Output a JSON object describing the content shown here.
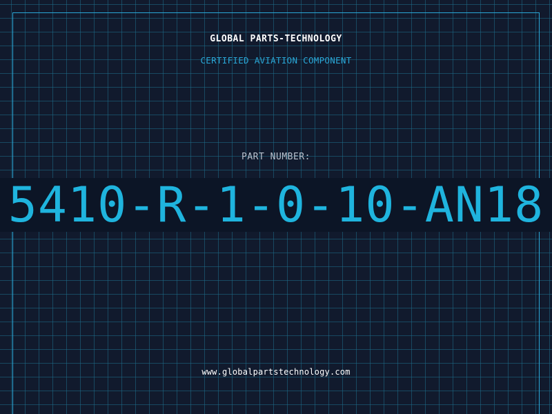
{
  "brand": {
    "company_name": "GLOBAL PARTS-TECHNOLOGY",
    "tagline": "CERTIFIED AVIATION COMPONENT"
  },
  "part": {
    "label": "PART NUMBER:",
    "number": "5410-R-1-0-10-AN18"
  },
  "footer": {
    "website": "www.globalpartstechnology.com"
  },
  "colors": {
    "background": "#111a2d",
    "grid": "#1e6e8c",
    "accent": "#2aa8d8",
    "text_primary": "#ffffff",
    "text_muted": "#b9c3cf"
  }
}
